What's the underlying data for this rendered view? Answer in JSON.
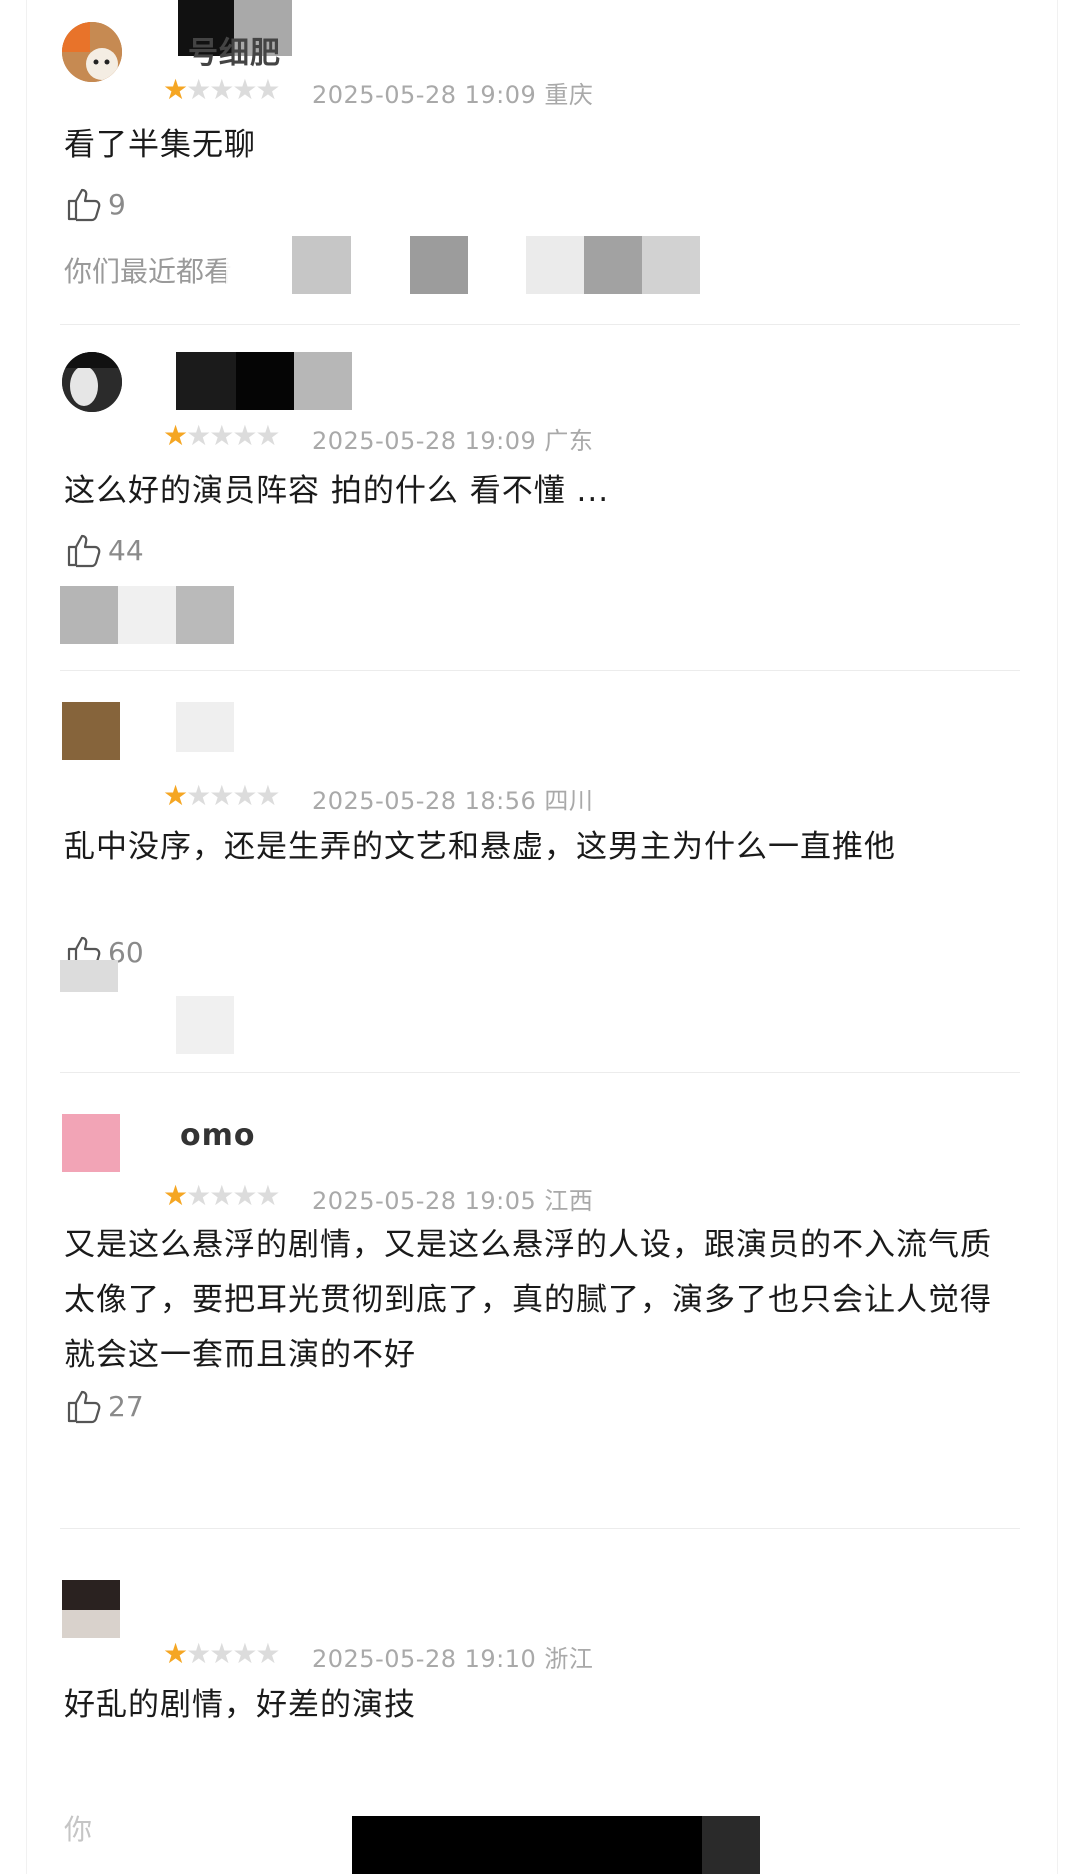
{
  "colors": {
    "star_active": "#f5a623",
    "star_inactive": "#dcdcdc",
    "meta_text": "#a9a9a9",
    "like_text": "#8a8a8a"
  },
  "reviews": [
    {
      "username": "号细肥",
      "rating": 1,
      "date": "2025-05-28 19:09",
      "location": "重庆",
      "content": "看了半集无聊",
      "likes": "9",
      "reply_preview": "你们最近都看"
    },
    {
      "username": "",
      "rating": 1,
      "date": "2025-05-28 19:09",
      "location": "广东",
      "content": "这么好的演员阵容 拍的什么 看不懂 ...",
      "likes": "44"
    },
    {
      "username": "",
      "rating": 1,
      "date": "2025-05-28 18:56",
      "location": "四川",
      "content": "乱中没序，还是生弄的文艺和悬虚，这男主为什么一直推他",
      "likes": "60"
    },
    {
      "username": "omo",
      "rating": 1,
      "date": "2025-05-28 19:05",
      "location": "江西",
      "content": "又是这么悬浮的剧情，又是这么悬浮的人设，跟演员的不入流气质太像了，要把耳光贯彻到底了，真的腻了，演多了也只会让人觉得就会这一套而且演的不好",
      "likes": "27"
    },
    {
      "username": "",
      "rating": 1,
      "date": "2025-05-28 19:10",
      "location": "浙江",
      "content": "好乱的剧情，好差的演技",
      "reply_preview": "你"
    }
  ]
}
